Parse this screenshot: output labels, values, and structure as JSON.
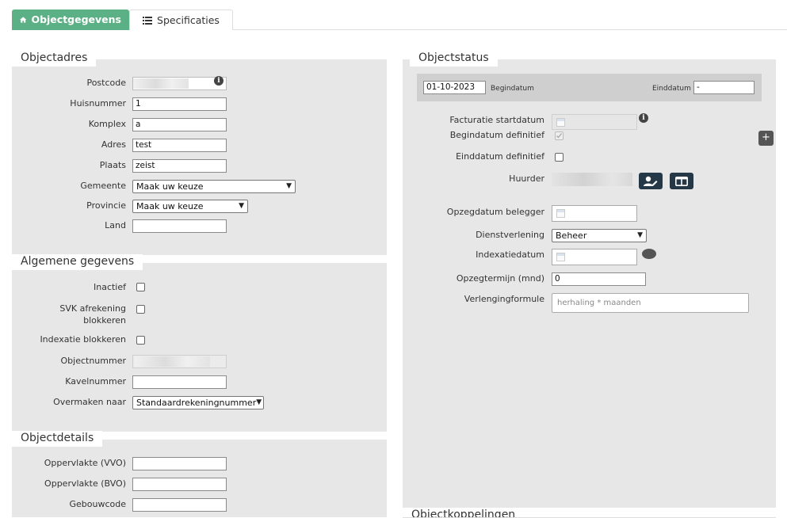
{
  "tabs": {
    "objectgegevens": "Objectgegevens",
    "specificaties": "Specificaties"
  },
  "objectadres": {
    "title": "Objectadres",
    "postcode_label": "Postcode",
    "huisnummer_label": "Huisnummer",
    "huisnummer_value": "1",
    "komplex_label": "Komplex",
    "komplex_value": "a",
    "adres_label": "Adres",
    "adres_value": "test",
    "plaats_label": "Plaats",
    "plaats_value": "zeist",
    "gemeente_label": "Gemeente",
    "gemeente_value": "Maak uw keuze",
    "provincie_label": "Provincie",
    "provincie_value": "Maak uw keuze",
    "land_label": "Land",
    "land_value": ""
  },
  "algemene": {
    "title": "Algemene gegevens",
    "inactief_label": "Inactief",
    "svk_label_1": "SVK afrekening",
    "svk_label_2": "blokkeren",
    "indexatie_label": "Indexatie blokkeren",
    "objectnummer_label": "Objectnummer",
    "kavelnummer_label": "Kavelnummer",
    "overmaken_label": "Overmaken naar",
    "overmaken_value": "Standaardrekeningnummer"
  },
  "objectdetails": {
    "title": "Objectdetails",
    "vvo_label": "Oppervlakte (VVO)",
    "bvo_label": "Oppervlakte (BVO)",
    "gebouwcode_label": "Gebouwcode"
  },
  "objectstatus": {
    "title": "Objectstatus",
    "begindatum_value": "01-10-2023",
    "begindatum_label": "Begindatum",
    "einddatum_label": "Einddatum",
    "einddatum_value": "-",
    "facturatie_label": "Facturatie startdatum",
    "begindatum_def_label": "Begindatum definitief",
    "einddatum_def_label": "Einddatum definitief",
    "huurder_label": "Huurder",
    "opzegdatum_label": "Opzegdatum belegger",
    "dienstverlening_label": "Dienstverlening",
    "dienstverlening_value": "Beheer",
    "indexatiedatum_label": "Indexatiedatum",
    "opzegtermijn_label": "Opzegtermijn (mnd)",
    "opzegtermijn_value": "0",
    "verlengingformule_label": "Verlengingformule",
    "verlengingformule_placeholder": "herhaling * maanden",
    "add_button": "+"
  },
  "objectkoppelingen": {
    "title": "Objectkoppelingen"
  },
  "colors": {
    "accent": "#5cb085",
    "panel": "#e7e7e7",
    "dark_button": "#253847"
  }
}
